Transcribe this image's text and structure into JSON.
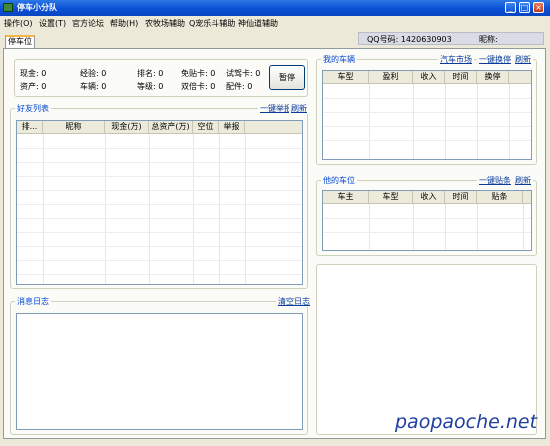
{
  "window": {
    "title": "停车小分队",
    "min": "_",
    "max": "□",
    "close": "×"
  },
  "menu": [
    "操作(O)",
    "设置(T)",
    "官方论坛",
    "帮助(H)",
    "农牧场辅助",
    "Q宠乐斗辅助",
    "神仙道辅助"
  ],
  "tabs": {
    "active": "停车位"
  },
  "qq": {
    "label": "QQ号码: 1420630903",
    "nick_label": "昵称:"
  },
  "stats": {
    "cash": "现金: 0",
    "assets": "资产: 0",
    "exp": "经验: 0",
    "cars": "车辆: 0",
    "rank": "排名: 0",
    "level": "等级: 0",
    "free_card": "免贴卡: 0",
    "double_card": "双倍卡: 0",
    "trial_card": "试驾卡: 0",
    "parts": "配件: 0",
    "pause_button": "暂停"
  },
  "friends": {
    "title": "好友列表",
    "report_all": "一键举报",
    "refresh": "刷新",
    "columns": [
      "排...",
      "昵称",
      "现金(万)",
      "总资产(万)",
      "空位",
      "举报"
    ]
  },
  "my_cars": {
    "title": "我的车辆",
    "market": "汽车市场",
    "swap_all": "一键换停",
    "refresh": "刷新",
    "columns": [
      "车型",
      "盈利",
      "收入",
      "时间",
      "换停"
    ]
  },
  "his_spots": {
    "title": "他的车位",
    "post_all": "一键贴条",
    "refresh": "刷新",
    "columns": [
      "车主",
      "车型",
      "收入",
      "时间",
      "贴条"
    ]
  },
  "log": {
    "title": "消息日志",
    "clear": "清空日志"
  },
  "watermark": "paopaoche.net",
  "colors": {
    "titlebar": "#0a4fd4",
    "link": "#0b3b9c",
    "group_title": "#0046d5"
  }
}
